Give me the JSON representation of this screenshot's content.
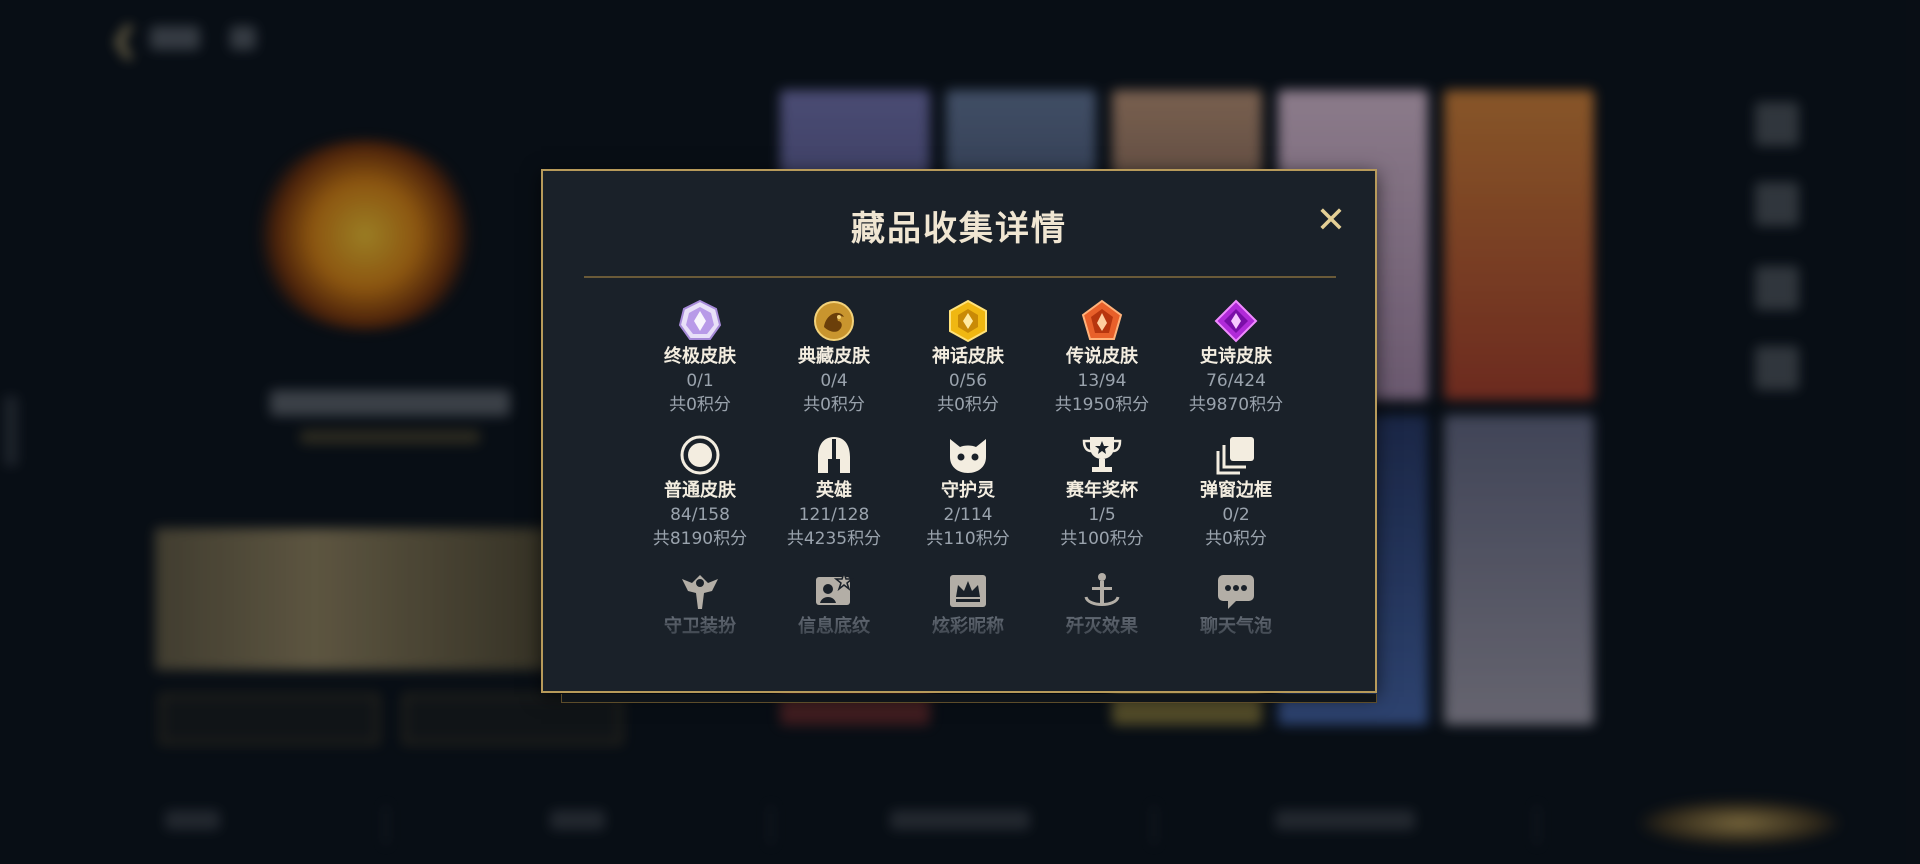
{
  "modal": {
    "title": "藏品收集详情",
    "close_icon": "close-icon"
  },
  "rows": [
    [
      {
        "icon": "ultimate-skin-icon",
        "name": "终极皮肤",
        "count": "0/1",
        "points": "共0积分"
      },
      {
        "icon": "collection-skin-icon",
        "name": "典藏皮肤",
        "count": "0/4",
        "points": "共0积分"
      },
      {
        "icon": "myth-skin-icon",
        "name": "神话皮肤",
        "count": "0/56",
        "points": "共0积分"
      },
      {
        "icon": "legend-skin-icon",
        "name": "传说皮肤",
        "count": "13/94",
        "points": "共1950积分"
      },
      {
        "icon": "epic-skin-icon",
        "name": "史诗皮肤",
        "count": "76/424",
        "points": "共9870积分"
      }
    ],
    [
      {
        "icon": "normal-skin-icon",
        "name": "普通皮肤",
        "count": "84/158",
        "points": "共8190积分"
      },
      {
        "icon": "helmet-icon",
        "name": "英雄",
        "count": "121/128",
        "points": "共4235积分"
      },
      {
        "icon": "spirit-icon",
        "name": "守护灵",
        "count": "2/114",
        "points": "共110积分"
      },
      {
        "icon": "trophy-icon",
        "name": "赛年奖杯",
        "count": "1/5",
        "points": "共100积分"
      },
      {
        "icon": "frames-icon",
        "name": "弹窗边框",
        "count": "0/2",
        "points": "共0积分"
      }
    ],
    [
      {
        "icon": "guard-outfit-icon",
        "name": "守卫装扮"
      },
      {
        "icon": "info-pattern-icon",
        "name": "信息底纹"
      },
      {
        "icon": "colorful-nickname-icon",
        "name": "炫彩昵称"
      },
      {
        "icon": "annihilation-effect-icon",
        "name": "歼灭效果"
      },
      {
        "icon": "chat-bubble-icon",
        "name": "聊天气泡"
      }
    ]
  ],
  "colors": {
    "modal_bg": "#1a2129",
    "border_gold": "#b79a5a",
    "title": "#f0e6d2",
    "muted": "#9aa3ad"
  }
}
